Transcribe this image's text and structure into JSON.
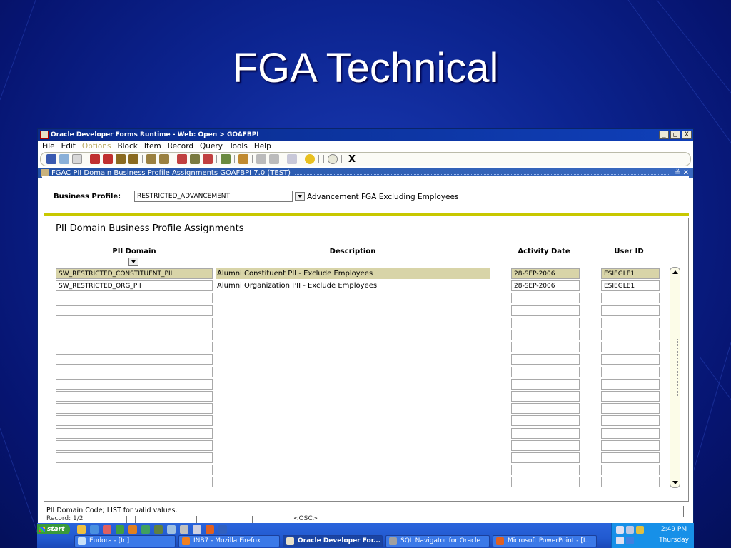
{
  "slide": {
    "title": "FGA Technical"
  },
  "window": {
    "title": "Oracle Developer Forms Runtime - Web:  Open > GOAFBPI",
    "buttons": [
      "_",
      "□",
      "X"
    ]
  },
  "menu": [
    "File",
    "Edit",
    "Options",
    "Block",
    "Item",
    "Record",
    "Query",
    "Tools",
    "Help"
  ],
  "toolbar": {
    "exit_label": "X"
  },
  "form": {
    "title": "FGAC PII Domain Business Profile Assignments  GOAFBPI  7.0  (TEST)",
    "controls": "≚ ✕"
  },
  "key_block": {
    "label": "Business Profile:",
    "value": "RESTRICTED_ADVANCEMENT",
    "description": "Advancement FGA Excluding Employees"
  },
  "detail_block": {
    "title": "PII Domain Business Profile Assignments",
    "columns": {
      "domain": "PII Domain",
      "description": "Description",
      "activity_date": "Activity Date",
      "user_id": "User ID"
    },
    "rows": [
      {
        "domain": "SW_RESTRICTED_CONSTITUENT_PII",
        "description": "Alumni Constituent PII - Exclude Employees",
        "activity_date": "28-SEP-2006",
        "user_id": "ESIEGLE1",
        "selected": true
      },
      {
        "domain": "SW_RESTRICTED_ORG_PII",
        "description": "Alumni Organization PII - Exclude Employees",
        "activity_date": "28-SEP-2006",
        "user_id": "ESIEGLE1",
        "selected": false
      },
      {
        "domain": "",
        "description": "",
        "activity_date": "",
        "user_id": "",
        "selected": false
      },
      {
        "domain": "",
        "description": "",
        "activity_date": "",
        "user_id": "",
        "selected": false
      },
      {
        "domain": "",
        "description": "",
        "activity_date": "",
        "user_id": "",
        "selected": false
      },
      {
        "domain": "",
        "description": "",
        "activity_date": "",
        "user_id": "",
        "selected": false
      },
      {
        "domain": "",
        "description": "",
        "activity_date": "",
        "user_id": "",
        "selected": false
      },
      {
        "domain": "",
        "description": "",
        "activity_date": "",
        "user_id": "",
        "selected": false
      },
      {
        "domain": "",
        "description": "",
        "activity_date": "",
        "user_id": "",
        "selected": false
      },
      {
        "domain": "",
        "description": "",
        "activity_date": "",
        "user_id": "",
        "selected": false
      },
      {
        "domain": "",
        "description": "",
        "activity_date": "",
        "user_id": "",
        "selected": false
      },
      {
        "domain": "",
        "description": "",
        "activity_date": "",
        "user_id": "",
        "selected": false
      },
      {
        "domain": "",
        "description": "",
        "activity_date": "",
        "user_id": "",
        "selected": false
      },
      {
        "domain": "",
        "description": "",
        "activity_date": "",
        "user_id": "",
        "selected": false
      },
      {
        "domain": "",
        "description": "",
        "activity_date": "",
        "user_id": "",
        "selected": false
      },
      {
        "domain": "",
        "description": "",
        "activity_date": "",
        "user_id": "",
        "selected": false
      },
      {
        "domain": "",
        "description": "",
        "activity_date": "",
        "user_id": "",
        "selected": false
      },
      {
        "domain": "",
        "description": "",
        "activity_date": "",
        "user_id": "",
        "selected": false
      }
    ]
  },
  "status": {
    "hint": "PII Domain Code; LIST for valid values.",
    "record": "Record: 1/2",
    "osc": "<OSC>"
  },
  "taskbar": {
    "start": "start",
    "windows": [
      {
        "label": "Eudora - [In]",
        "icon_color": "#c8e0f8",
        "active": false
      },
      {
        "label": "INB7 - Mozilla Firefox",
        "icon_color": "#f08020",
        "active": false
      },
      {
        "label": "Oracle Developer For...",
        "icon_color": "#e8e0c8",
        "active": true
      },
      {
        "label": "SQL Navigator for Oracle",
        "icon_color": "#a0a0a0",
        "active": false
      },
      {
        "label": "Microsoft PowerPoint - [I...",
        "icon_color": "#e06020",
        "active": false
      }
    ],
    "clock": "2:49 PM",
    "day": "Thursday"
  },
  "colors": {
    "slide_bg": "#0c2490",
    "title_bar": "#0a2a8a",
    "form_bar": "#2554a8",
    "selected_row": "#d8d4a8",
    "separator": "#c8c800"
  }
}
